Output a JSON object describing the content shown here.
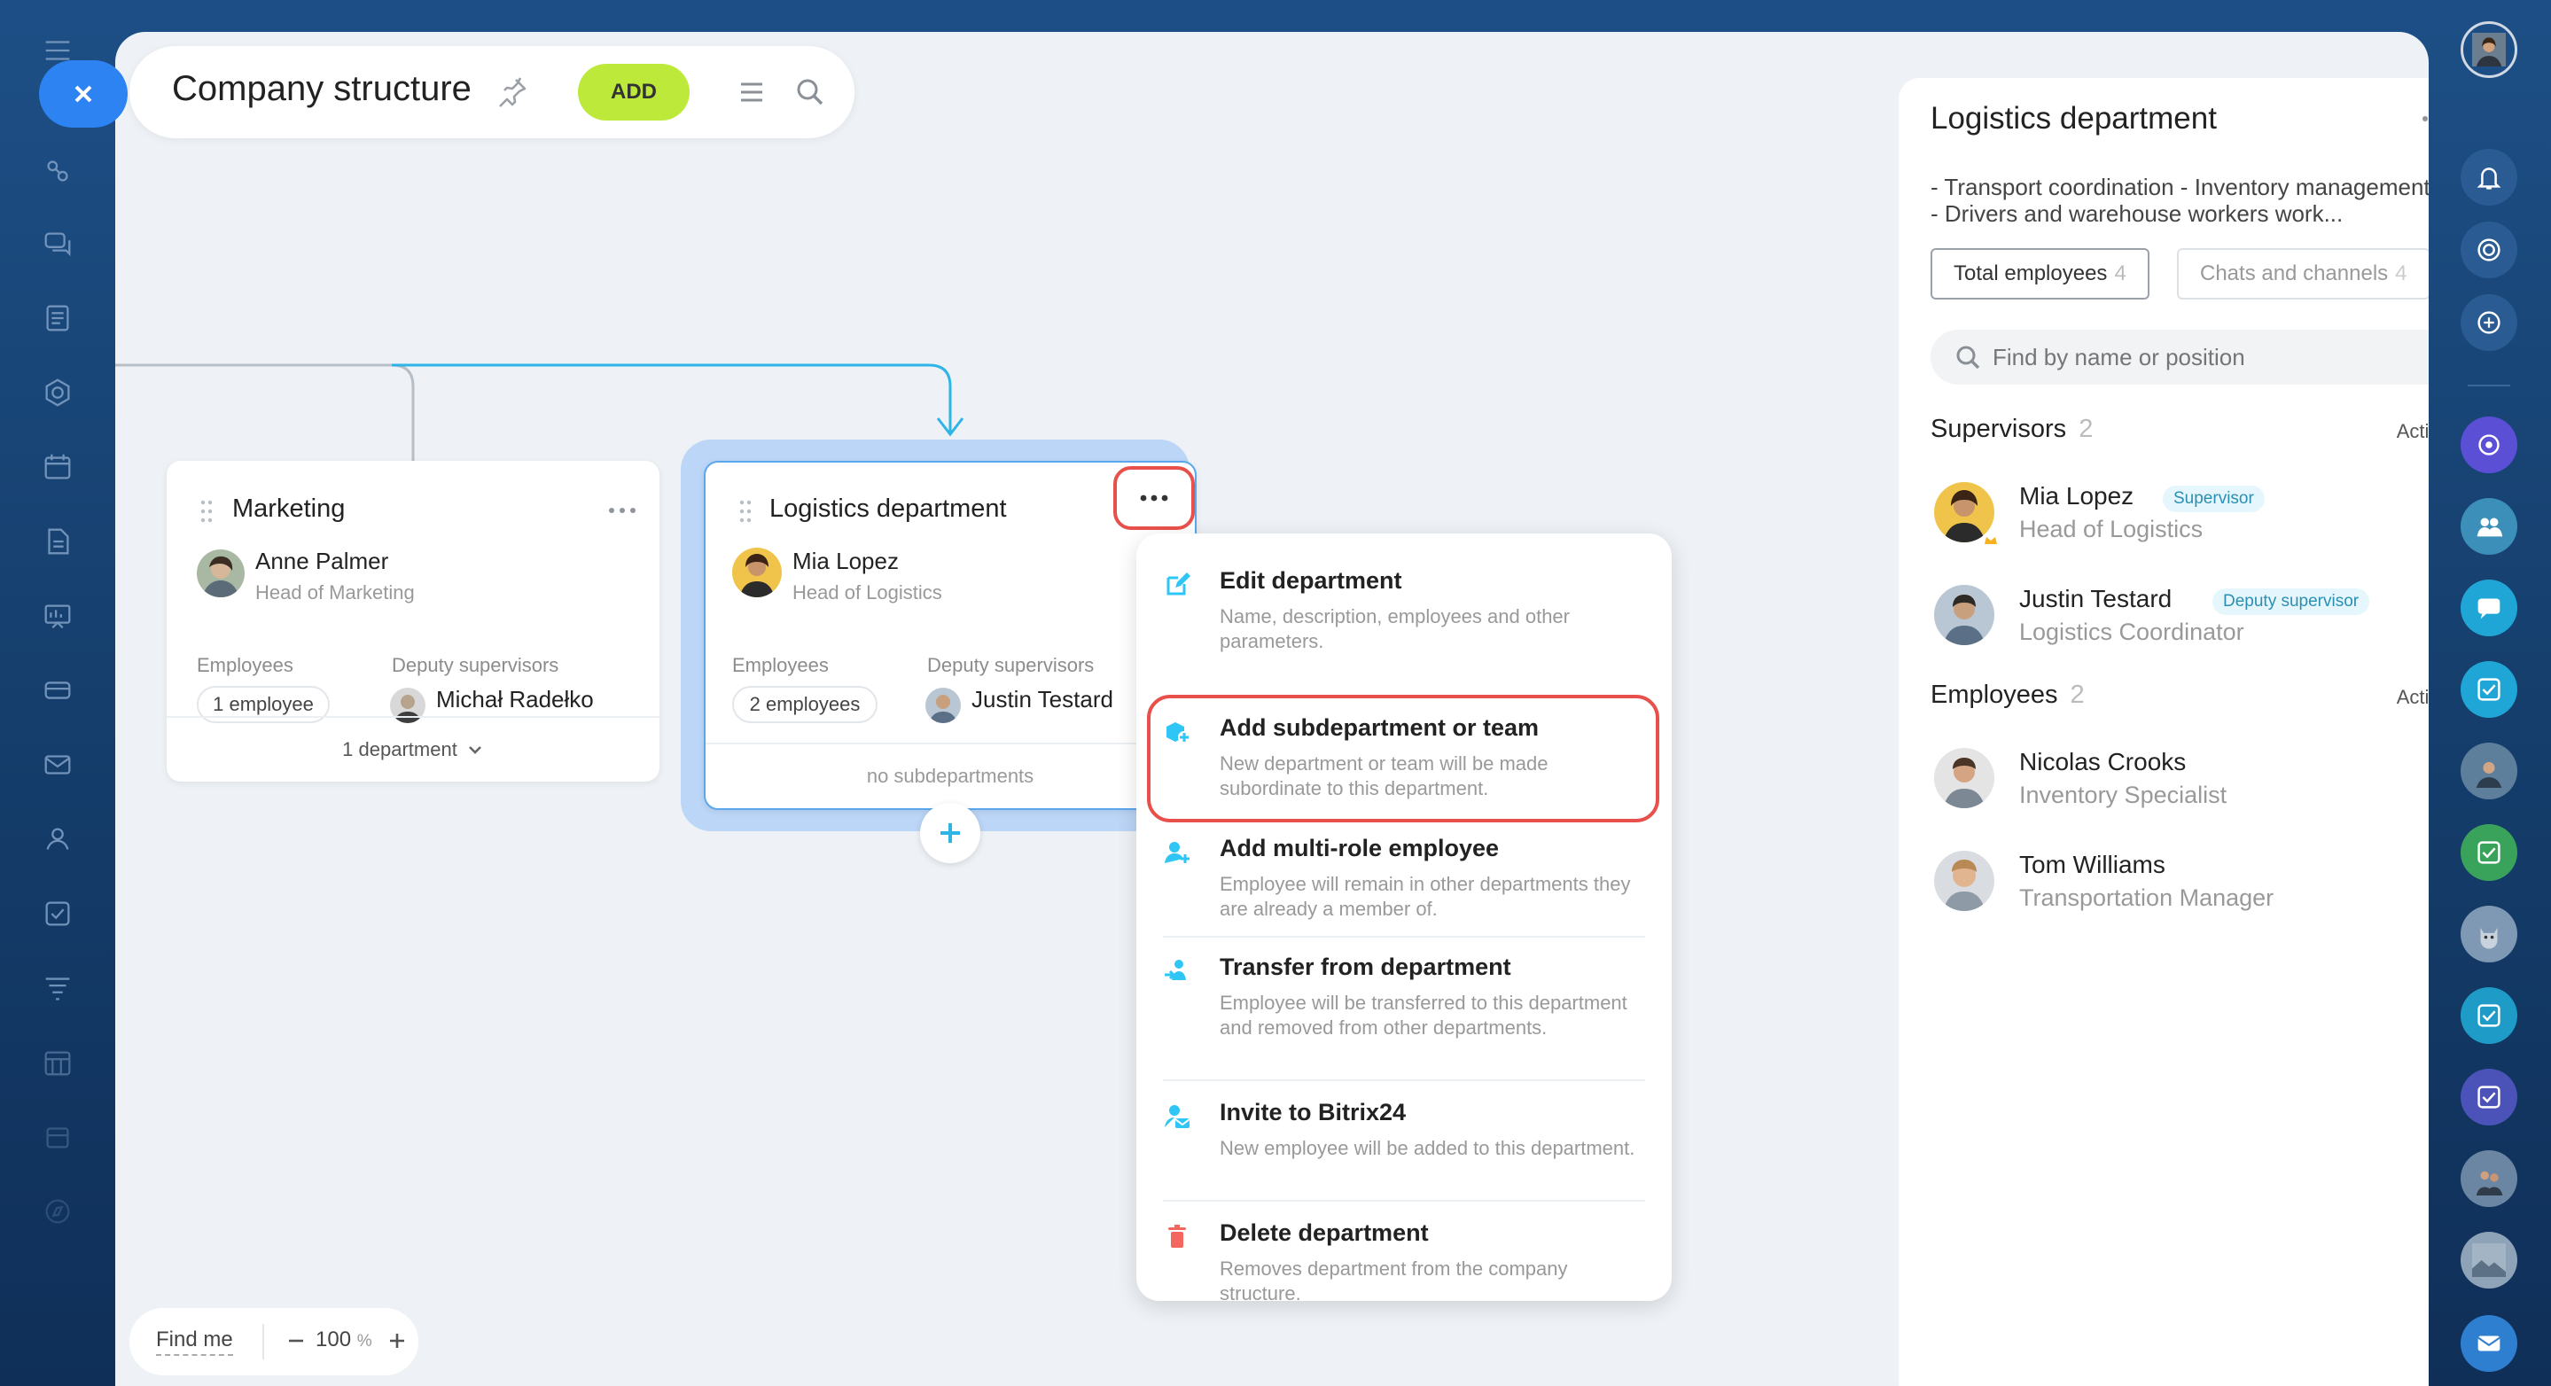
{
  "app": {
    "title": "Company structure",
    "add_label": "ADD"
  },
  "chart": {
    "marketing": {
      "title": "Marketing",
      "head_name": "Anne Palmer",
      "head_role": "Head of Marketing",
      "employees_label": "Employees",
      "employees_count": "1 employee",
      "deputy_label": "Deputy supervisors",
      "deputy_name": "Michał Radełko",
      "footer": "1 department"
    },
    "logistics": {
      "title": "Logistics department",
      "head_name": "Mia Lopez",
      "head_role": "Head of Logistics",
      "employees_label": "Employees",
      "employees_count": "2 employees",
      "deputy_label": "Deputy supervisors",
      "deputy_name": "Justin Testard",
      "footer": "no subdepartments"
    }
  },
  "menu": {
    "items": [
      {
        "title": "Edit department",
        "desc": "Name, description, employees and other parameters.",
        "icon": "edit-icon",
        "color": "#2fc6f6"
      },
      {
        "title": "Add subdepartment or team",
        "desc": "New department or team will be made subordinate to this department.",
        "icon": "add-subdepartment-icon",
        "color": "#2fc6f6"
      },
      {
        "title": "Add multi-role employee",
        "desc": "Employee will remain in other departments they are already a member of.",
        "icon": "add-employee-icon",
        "color": "#2fc6f6"
      },
      {
        "title": "Transfer from department",
        "desc": "Employee will be transferred to this department and removed from other departments.",
        "icon": "transfer-icon",
        "color": "#2fc6f6"
      },
      {
        "title": "Invite to Bitrix24",
        "desc": "New employee will be added to this department.",
        "icon": "invite-icon",
        "color": "#2fc6f6"
      },
      {
        "title": "Delete department",
        "desc": "Removes department from the company structure.",
        "icon": "trash-icon",
        "color": "#f4675f"
      }
    ]
  },
  "panel": {
    "title": "Logistics department",
    "desc_line1": "- Transport coordination - Inventory management",
    "desc_line2": "- Drivers and warehouse workers work...",
    "tab_total": "Total employees",
    "tab_total_count": "4",
    "tab_chats": "Chats and channels",
    "tab_chats_count": "4",
    "search_placeholder": "Find by name or position",
    "supervisors_label": "Supervisors",
    "supervisors_count": "2",
    "employees_label": "Employees",
    "employees_count": "2",
    "actions_label": "Actions",
    "supervisors": [
      {
        "name": "Mia Lopez",
        "badge": "Supervisor",
        "role": "Head of Logistics"
      },
      {
        "name": "Justin Testard",
        "badge": "Deputy supervisor",
        "role": "Logistics Coordinator"
      }
    ],
    "employees": [
      {
        "name": "Nicolas Crooks",
        "role": "Inventory Specialist"
      },
      {
        "name": "Tom Williams",
        "role": "Transportation Manager"
      }
    ]
  },
  "zoom": {
    "find_me": "Find me",
    "level": "100",
    "unit": "%"
  },
  "colors": {
    "accent_blue": "#2d83f2",
    "add_green": "#bdea3a",
    "connector": "#2fb4e6",
    "highlight_red": "#e8514b",
    "selected_card_glow": "#bcd6f7"
  }
}
